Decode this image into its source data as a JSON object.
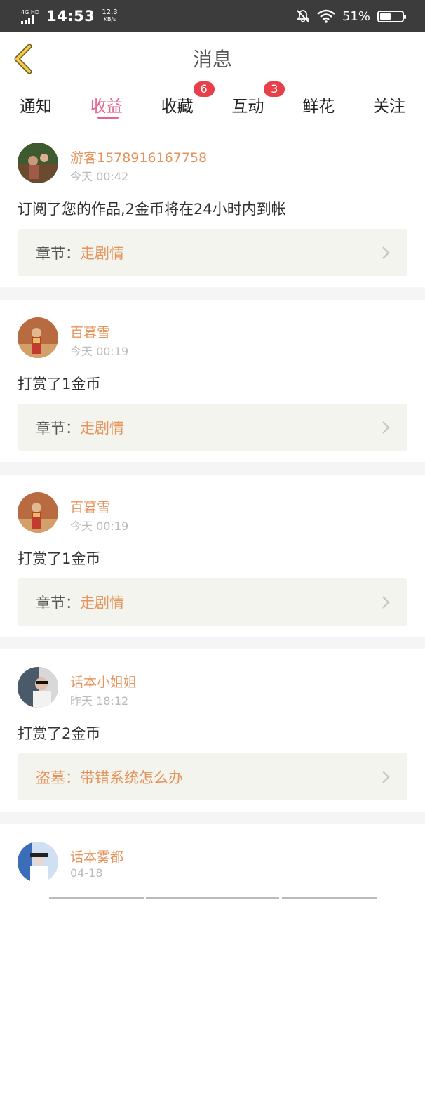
{
  "status_bar": {
    "network": "4G HD",
    "time": "14:53",
    "speed_value": "12.3",
    "speed_unit": "KB/s",
    "battery": "51%",
    "battery_level": 0.51
  },
  "header": {
    "title": "消息"
  },
  "tabs": [
    {
      "label": "通知",
      "active": false,
      "badge": ""
    },
    {
      "label": "收益",
      "active": true,
      "badge": ""
    },
    {
      "label": "收藏",
      "active": false,
      "badge": "6"
    },
    {
      "label": "互动",
      "active": false,
      "badge": "3"
    },
    {
      "label": "鲜花",
      "active": false,
      "badge": ""
    },
    {
      "label": "关注",
      "active": false,
      "badge": ""
    }
  ],
  "messages": [
    {
      "user": "游客1578916167758",
      "time": "今天 00:42",
      "content": "订阅了您的作品,2金币将在24小时内到帐",
      "link_label": "章节：",
      "link_title": "走剧情"
    },
    {
      "user": "百暮雪",
      "time": "今天 00:19",
      "content": "打赏了1金币",
      "link_label": "章节：",
      "link_title": "走剧情"
    },
    {
      "user": "百暮雪",
      "time": "今天 00:19",
      "content": "打赏了1金币",
      "link_label": "章节：",
      "link_title": "走剧情"
    },
    {
      "user": "话本小姐姐",
      "time": "昨天 18:12",
      "content": "打赏了2金币",
      "link_label": "盗墓：",
      "link_title": "带错系统怎么办"
    },
    {
      "user": "话本雾都",
      "time": "04-18",
      "content": "",
      "link_label": "",
      "link_title": ""
    }
  ],
  "colors": {
    "accent": "#e7638c",
    "username": "#e5935a",
    "badge": "#e8404b",
    "card_bg": "#f4f4ee"
  }
}
